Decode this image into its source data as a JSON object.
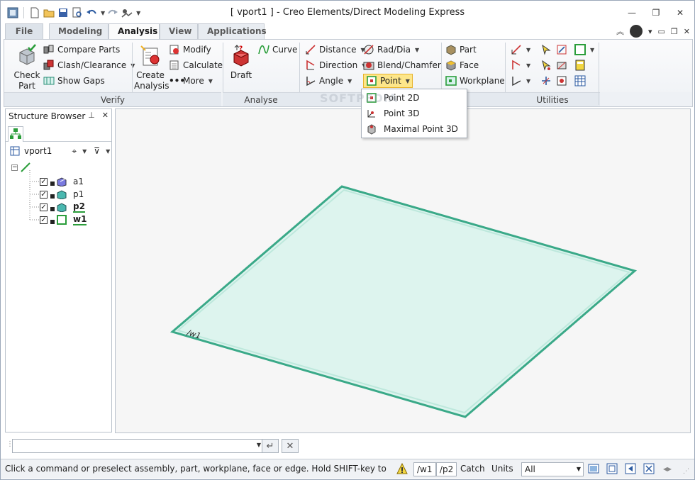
{
  "window": {
    "title": "[ vport1 ] - Creo Elements/Direct Modeling Express"
  },
  "tabs": [
    {
      "label": "File"
    },
    {
      "label": "Modeling"
    },
    {
      "label": "Analysis"
    },
    {
      "label": "View"
    },
    {
      "label": "Applications"
    }
  ],
  "ribbon": {
    "verify": {
      "label": "Verify",
      "check_part": "Check\nPart",
      "compare_parts": "Compare Parts",
      "clash_clearance": "Clash/Clearance",
      "show_gaps": "Show Gaps",
      "create_analysis": "Create\nAnalysis",
      "modify": "Modify",
      "calculate": "Calculate",
      "more": "More"
    },
    "analyse": {
      "label": "Analyse",
      "draft": "Draft",
      "curve": "Curve"
    },
    "measure": {
      "distance": "Distance",
      "direction": "Direction",
      "angle": "Angle",
      "rad_dia": "Rad/Dia",
      "blend_chamfer": "Blend/Chamfer",
      "point": "Point"
    },
    "snap": {
      "part": "Part",
      "face": "Face",
      "workplane": "Workplane"
    },
    "utilities": {
      "label": "Utilities"
    }
  },
  "point_menu": {
    "items": [
      "Point 2D",
      "Point 3D",
      "Maximal Point 3D"
    ]
  },
  "structure_browser": {
    "title": "Structure Browser",
    "vport": "vport1",
    "items": [
      {
        "label": "a1",
        "bold": false
      },
      {
        "label": "p1",
        "bold": false
      },
      {
        "label": "p2",
        "bold": true
      },
      {
        "label": "w1",
        "bold": true
      }
    ]
  },
  "viewport": {
    "workplane_label": "/w1"
  },
  "command_line": {
    "value": ""
  },
  "status_bar": {
    "message": "Click a command or preselect assembly, part, workplane, face or edge. Hold SHIFT-key to select m...",
    "workplane": "/w1",
    "part": "/p2",
    "catch": "Catch",
    "units": "Units",
    "filter": "All"
  },
  "watermark": "SOFTPEDIA",
  "colors": {
    "accent": "#1f6fb5",
    "workplane_fill": "#dff4ef",
    "workplane_edge": "#3aa988",
    "point_highlight": "#fde68a"
  }
}
